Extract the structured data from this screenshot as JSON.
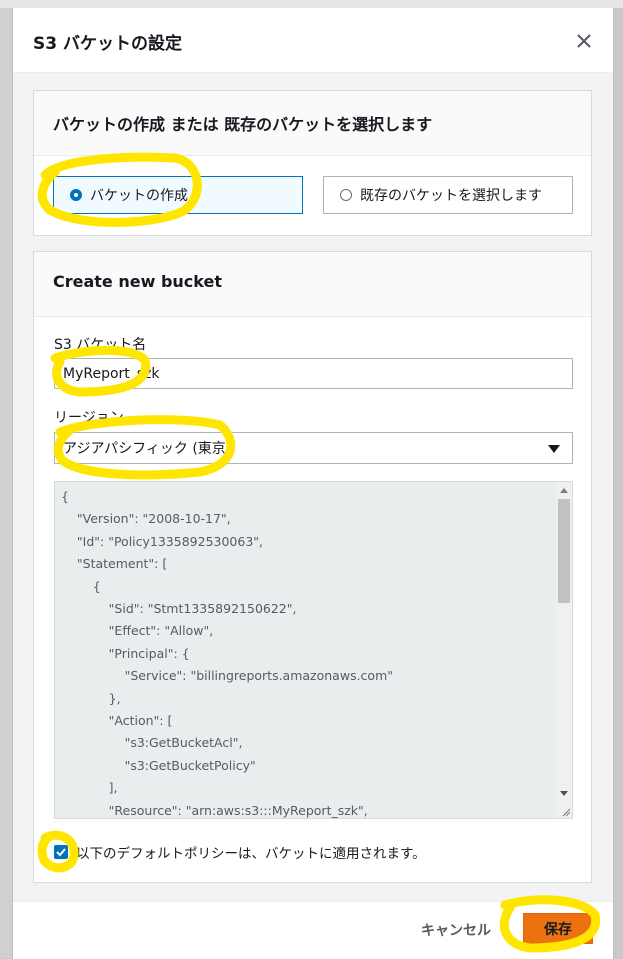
{
  "modal": {
    "title": "S3 バケットの設定"
  },
  "bucket_choice": {
    "heading": "バケットの作成 または 既存のバケットを選択します",
    "options": [
      {
        "label": "バケットの作成",
        "selected": true
      },
      {
        "label": "既存のバケットを選択します",
        "selected": false
      }
    ]
  },
  "create_bucket": {
    "heading": "Create new bucket",
    "bucket_name_label": "S3 バケット名",
    "bucket_name_value": "MyReport_szk",
    "region_label": "リージョン",
    "region_value": "アジアパシフィック (東京)",
    "policy_lines": [
      "{",
      "    \"Version\": \"2008-10-17\",",
      "    \"Id\": \"Policy1335892530063\",",
      "    \"Statement\": [",
      "        {",
      "            \"Sid\": \"Stmt1335892150622\",",
      "            \"Effect\": \"Allow\",",
      "            \"Principal\": {",
      "                \"Service\": \"billingreports.amazonaws.com\"",
      "            },",
      "            \"Action\": [",
      "                \"s3:GetBucketAcl\",",
      "                \"s3:GetBucketPolicy\"",
      "            ],",
      "            \"Resource\": \"arn:aws:s3:::MyReport_szk\","
    ],
    "default_policy_checked": true,
    "default_policy_label": "以下のデフォルトポリシーは、バケットに適用されます。"
  },
  "footer": {
    "cancel_label": "キャンセル",
    "save_label": "保存"
  },
  "colors": {
    "primary_button": "#ec7211",
    "selection_blue": "#0073bb",
    "highlight_yellow": "#ffe600"
  }
}
